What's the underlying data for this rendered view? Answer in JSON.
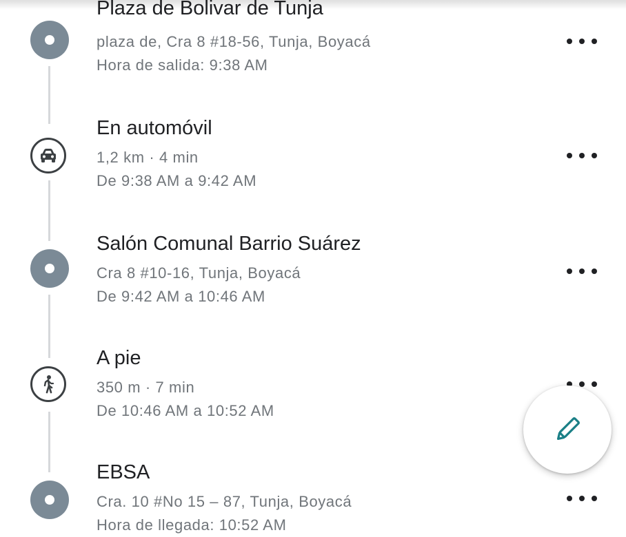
{
  "items": [
    {
      "kind": "stop",
      "title": "Plaza de Bolivar de Tunja",
      "line1": "plaza de, Cra 8 #18-56, Tunja, Boyacá",
      "line2": "Hora de salida: 9:38 AM",
      "more_icon": "more-horiz-icon"
    },
    {
      "kind": "travel",
      "icon": "car-icon",
      "title": "En automóvil",
      "line1": "1,2 km · 4 min",
      "line2": "De 9:38 AM a 9:42 AM",
      "more_icon": "more-horiz-icon"
    },
    {
      "kind": "stop",
      "title": "Salón Comunal Barrio Suárez",
      "line1": "Cra 8 #10-16, Tunja, Boyacá",
      "line2": "De 9:42 AM a 10:46 AM",
      "more_icon": "more-horiz-icon"
    },
    {
      "kind": "travel",
      "icon": "walk-icon",
      "title": "A pie",
      "line1": "350 m · 7 min",
      "line2": "De 10:46 AM a 10:52 AM",
      "more_icon": "more-horiz-icon"
    },
    {
      "kind": "stop",
      "title": "EBSA",
      "line1": "Cra. 10 #No 15 – 87, Tunja, Boyacá",
      "line2": "Hora de llegada: 10:52 AM",
      "more_icon": "more-horiz-icon"
    }
  ],
  "fab": {
    "icon": "pencil-icon",
    "color": "#1a7f86"
  },
  "colors": {
    "stop_dot": "#7b8a96",
    "secondary_text": "#70757a",
    "timeline": "#d6d8db"
  }
}
